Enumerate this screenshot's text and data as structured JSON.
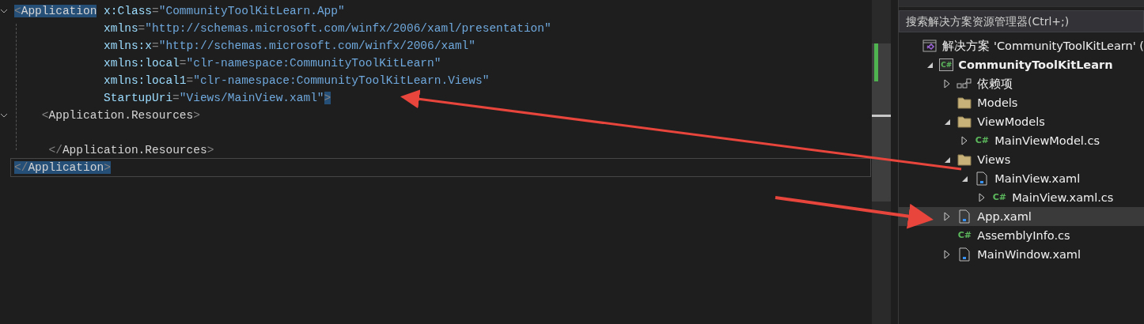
{
  "editor": {
    "lines": [
      {
        "kind": "root",
        "foldable": true,
        "current": false,
        "tokens": [
          {
            "kind": "punct",
            "text": "<",
            "highlighted": true
          },
          {
            "kind": "tag",
            "text": "Application",
            "highlighted": true
          },
          {
            "kind": "attr",
            "text": " x:Class",
            "highlighted": false
          },
          {
            "kind": "punct",
            "text": "=",
            "highlighted": false
          },
          {
            "kind": "value",
            "text": "\"CommunityToolKitLearn.App\"",
            "highlighted": false
          }
        ]
      },
      {
        "kind": "attr",
        "foldable": false,
        "current": false,
        "tokens": [
          {
            "kind": "attr",
            "text": "xmlns",
            "highlighted": false
          },
          {
            "kind": "punct",
            "text": "=",
            "highlighted": false
          },
          {
            "kind": "value",
            "text": "\"http://schemas.microsoft.com/winfx/2006/xaml/presentation\"",
            "highlighted": false
          }
        ]
      },
      {
        "kind": "attr",
        "foldable": false,
        "current": false,
        "tokens": [
          {
            "kind": "attr",
            "text": "xmlns:x",
            "highlighted": false
          },
          {
            "kind": "punct",
            "text": "=",
            "highlighted": false
          },
          {
            "kind": "value",
            "text": "\"http://schemas.microsoft.com/winfx/2006/xaml\"",
            "highlighted": false
          }
        ]
      },
      {
        "kind": "attr",
        "foldable": false,
        "current": false,
        "tokens": [
          {
            "kind": "attr",
            "text": "xmlns:local",
            "highlighted": false
          },
          {
            "kind": "punct",
            "text": "=",
            "highlighted": false
          },
          {
            "kind": "value",
            "text": "\"clr-namespace:CommunityToolKitLearn\"",
            "highlighted": false
          }
        ]
      },
      {
        "kind": "attr",
        "foldable": false,
        "current": false,
        "tokens": [
          {
            "kind": "attr",
            "text": "xmlns:local1",
            "highlighted": false
          },
          {
            "kind": "punct",
            "text": "=",
            "highlighted": false
          },
          {
            "kind": "value",
            "text": "\"clr-namespace:CommunityToolKitLearn.Views\"",
            "highlighted": false
          }
        ]
      },
      {
        "kind": "attr",
        "foldable": false,
        "current": false,
        "tokens": [
          {
            "kind": "attr",
            "text": "StartupUri",
            "highlighted": false
          },
          {
            "kind": "punct",
            "text": "=",
            "highlighted": false
          },
          {
            "kind": "value",
            "text": "\"Views/MainView.xaml\"",
            "highlighted": false
          },
          {
            "kind": "punct",
            "text": ">",
            "highlighted": true
          }
        ]
      },
      {
        "kind": "child",
        "foldable": true,
        "current": false,
        "tokens": [
          {
            "kind": "punct",
            "text": "<",
            "highlighted": false
          },
          {
            "kind": "tag",
            "text": "Application.Resources",
            "highlighted": false
          },
          {
            "kind": "punct",
            "text": ">",
            "highlighted": false
          }
        ]
      },
      {
        "kind": "blank",
        "foldable": false,
        "current": false
      },
      {
        "kind": "child-close",
        "foldable": false,
        "current": false,
        "tokens": [
          {
            "kind": "punct",
            "text": "</",
            "highlighted": false
          },
          {
            "kind": "tag",
            "text": "Application.Resources",
            "highlighted": false
          },
          {
            "kind": "punct",
            "text": ">",
            "highlighted": false
          }
        ]
      },
      {
        "kind": "root",
        "foldable": false,
        "current": true,
        "tokens": [
          {
            "kind": "punct",
            "text": "</",
            "highlighted": true
          },
          {
            "kind": "tag",
            "text": "Application",
            "highlighted": true
          },
          {
            "kind": "punct",
            "text": ">",
            "highlighted": true
          }
        ]
      }
    ]
  },
  "solution_explorer": {
    "search": {
      "placeholder": "搜索解决方案资源管理器(Ctrl+;)"
    },
    "tree": [
      {
        "kind": "solution",
        "label": "解决方案 'CommunityToolKitLearn' (",
        "bold": false,
        "selected": false,
        "children": [
          {
            "kind": "project",
            "icon_text": "C#",
            "label": "CommunityToolKitLearn",
            "bold": true,
            "expanded": true,
            "selected": false,
            "children": [
              {
                "kind": "dependencies",
                "label": "依赖项",
                "bold": false,
                "expanded": false,
                "selected": false
              },
              {
                "kind": "folder",
                "label": "Models",
                "bold": false,
                "selected": false
              },
              {
                "kind": "folder",
                "label": "ViewModels",
                "bold": false,
                "expanded": true,
                "selected": false,
                "children": [
                  {
                    "kind": "csharp",
                    "icon_text": "C#",
                    "label": "MainViewModel.cs",
                    "bold": false,
                    "expanded": false,
                    "selected": false
                  }
                ]
              },
              {
                "kind": "folder",
                "label": "Views",
                "bold": false,
                "expanded": true,
                "selected": false,
                "children": [
                  {
                    "kind": "xaml",
                    "label": "MainView.xaml",
                    "bold": false,
                    "expanded": true,
                    "selected": false,
                    "children": [
                      {
                        "kind": "csharp",
                        "icon_text": "C#",
                        "label": "MainView.xaml.cs",
                        "bold": false,
                        "expanded": false,
                        "selected": false
                      }
                    ]
                  }
                ]
              },
              {
                "kind": "xaml",
                "label": "App.xaml",
                "bold": false,
                "expanded": false,
                "selected": true
              },
              {
                "kind": "csharp",
                "icon_text": "C#",
                "label": "AssemblyInfo.cs",
                "bold": false,
                "selected": false
              },
              {
                "kind": "xaml",
                "label": "MainWindow.xaml",
                "bold": false,
                "expanded": false,
                "selected": false
              }
            ]
          }
        ]
      }
    ]
  }
}
